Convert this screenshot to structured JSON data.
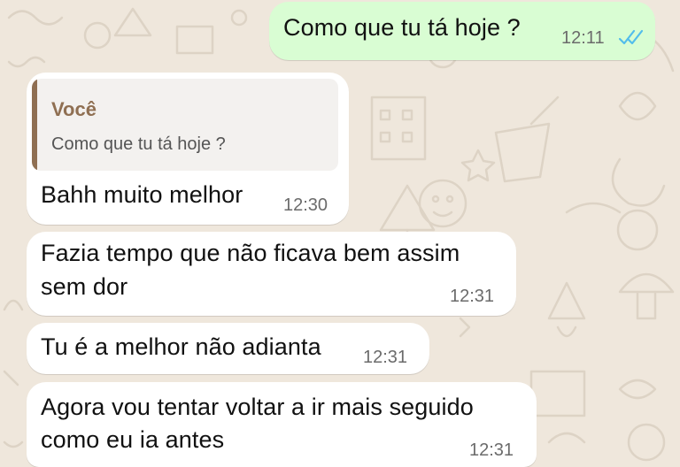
{
  "chat": {
    "colors": {
      "wallpaper": "#efe7dc",
      "incoming_bubble": "#ffffff",
      "outgoing_bubble": "#d9fdd3",
      "read_ticks": "#53bdeb",
      "quote_accent": "#8f6f52"
    },
    "messages": [
      {
        "direction": "outgoing",
        "text": "Como que tu tá hoje ?",
        "time": "12:11",
        "status_icon": "double-check-read-icon"
      },
      {
        "direction": "incoming",
        "reply_to": {
          "author": "Você",
          "text": "Como que tu tá hoje ?"
        },
        "text": "Bahh muito melhor",
        "time": "12:30"
      },
      {
        "direction": "incoming",
        "lines": [
          "Fazia tempo que não ficava bem assim",
          "sem dor"
        ],
        "time": "12:31"
      },
      {
        "direction": "incoming",
        "text": "Tu é a melhor não adianta",
        "time": "12:31"
      },
      {
        "direction": "incoming",
        "lines": [
          "Agora vou tentar voltar a ir mais seguido",
          "como eu ia antes"
        ],
        "time": "12:31"
      }
    ]
  }
}
